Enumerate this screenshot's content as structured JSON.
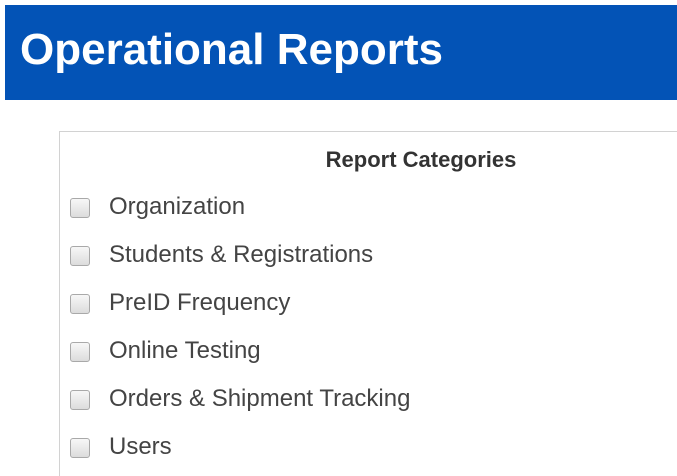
{
  "header": {
    "title": "Operational Reports",
    "background_color": "#0353b6"
  },
  "panel": {
    "title": "Report Categories",
    "categories": [
      {
        "label": "Organization",
        "checked": false
      },
      {
        "label": "Students & Registrations",
        "checked": false
      },
      {
        "label": "PreID Frequency",
        "checked": false
      },
      {
        "label": "Online Testing",
        "checked": false
      },
      {
        "label": "Orders & Shipment Tracking",
        "checked": false
      },
      {
        "label": "Users",
        "checked": false
      }
    ]
  }
}
